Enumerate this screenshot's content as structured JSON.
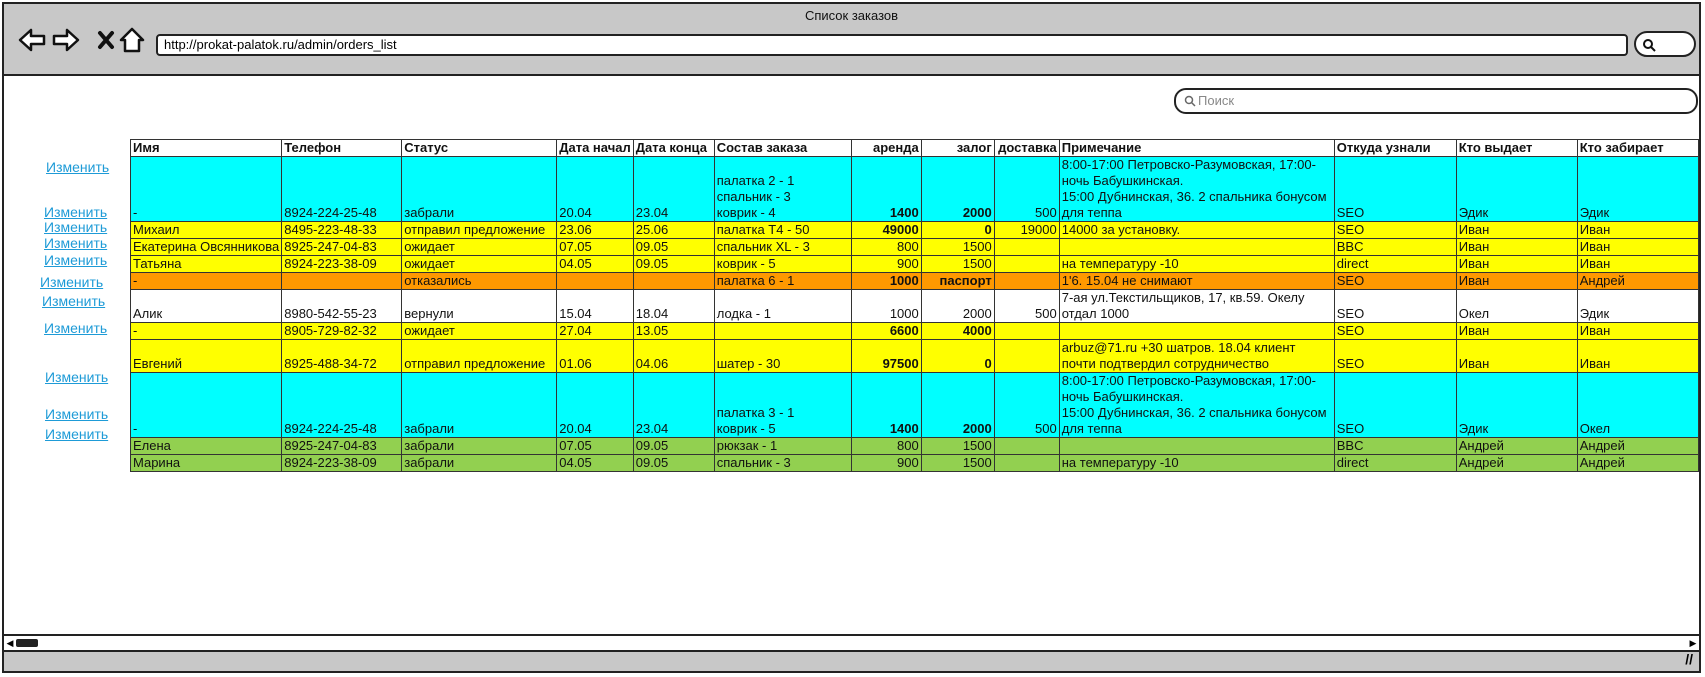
{
  "window": {
    "title": "Список заказов"
  },
  "nav": {
    "url": "http://prokat-palatok.ru/admin/orders_list"
  },
  "search": {
    "placeholder": "Поиск"
  },
  "edit_label": "Изменить",
  "colors": {
    "cyan": "#00ffff",
    "yellow": "#ffff00",
    "orange": "#ff9900",
    "white": "#ffffff",
    "green": "#92d050",
    "link": "#1e9bd7"
  },
  "table": {
    "headers": [
      "Имя",
      "Телефон",
      "Статус",
      "Дата начал",
      "Дата конца",
      "Состав заказа",
      "аренда",
      "залог",
      "доставка",
      "Примечание",
      "Откуда узнали",
      "Кто выдает",
      "Кто забирает"
    ],
    "rows": [
      {
        "color": "cyan",
        "cells": [
          "-",
          "8924-224-25-48",
          "забрали",
          "20.04",
          "23.04",
          "палатка 2 - 1\nспальник - 3\nковрик - 4",
          "1400",
          "2000",
          "500",
          "8:00-17:00 Петровско-Разумовская, 17:00-ночь Бабушкинская.\n15:00 Дубнинская, 36. 2 спальника бонусом для теппа",
          "SEO",
          "Эдик",
          "Эдик"
        ]
      },
      {
        "color": "yellow",
        "cells": [
          "Михаил",
          "8495-223-48-33",
          "отправил предложение",
          "23.06",
          "25.06",
          "палатка Т4  - 50",
          "49000",
          "0",
          "19000",
          "14000 за установку.",
          "SEO",
          "Иван",
          "Иван"
        ]
      },
      {
        "color": "yellow",
        "cells": [
          "Екатерина Овсянникова",
          "8925-247-04-83",
          "ожидает",
          "07.05",
          "09.05",
          "спальник XL - 3",
          "800",
          "1500",
          "",
          "",
          "BBC",
          "Иван",
          "Иван"
        ]
      },
      {
        "color": "yellow",
        "cells": [
          "Татьяна",
          "8924-223-38-09",
          "ожидает",
          "04.05",
          "09.05",
          "коврик - 5",
          "900",
          "1500",
          "",
          "на температуру -10",
          "direct",
          "Иван",
          "Иван"
        ]
      },
      {
        "color": "orange",
        "cells": [
          "-",
          "",
          "отказались",
          "",
          "",
          "палатка 6 - 1",
          "1000",
          "паспорт",
          "",
          "1'6. 15.04 не снимают",
          "SEO",
          "Иван",
          "Андрей"
        ]
      },
      {
        "color": "white",
        "cells": [
          "Алик",
          "8980-542-55-23",
          "вернули",
          "15.04",
          "18.04",
          "лодка - 1",
          "1000",
          "2000",
          "500",
          "7-ая ул.Текстильщиков, 17, кв.59. Окелу отдал 1000",
          "SEO",
          "Окел",
          "Эдик"
        ]
      },
      {
        "color": "yellow",
        "cells": [
          "-",
          "8905-729-82-32",
          "ожидает",
          "27.04",
          "13.05",
          "",
          "6600",
          "4000",
          "",
          "",
          "SEO",
          "Иван",
          "Иван"
        ]
      },
      {
        "color": "yellow",
        "cells": [
          "Евгений",
          "8925-488-34-72",
          "отправил предложение",
          "01.06",
          "04.06",
          "шатер - 30",
          "97500",
          "0",
          "",
          "arbuz@71.ru +30 шатров. 18.04 клиент почти подтвердил сотрудничество",
          "SEO",
          "Иван",
          "Иван"
        ]
      },
      {
        "color": "cyan",
        "cells": [
          "-",
          "8924-224-25-48",
          "забрали",
          "20.04",
          "23.04",
          "палатка 3 - 1\nковрик - 5",
          "1400",
          "2000",
          "500",
          "8:00-17:00 Петровско-Разумовская, 17:00-ночь Бабушкинская.\n15:00 Дубнинская, 36. 2 спальника бонусом для теппа",
          "SEO",
          "Эдик",
          "Окел"
        ]
      },
      {
        "color": "green",
        "cells": [
          "Елена",
          "8925-247-04-83",
          "забрали",
          "07.05",
          "09.05",
          "рюкзак - 1",
          "800",
          "1500",
          "",
          "",
          "BBC",
          "Андрей",
          "Андрей"
        ]
      },
      {
        "color": "green",
        "cells": [
          "Марина",
          "8924-223-38-09",
          "забрали",
          "04.05",
          "09.05",
          "спальник - 3",
          "900",
          "1500",
          "",
          "на температуру -10",
          "direct",
          "Андрей",
          "Андрей"
        ]
      }
    ]
  }
}
